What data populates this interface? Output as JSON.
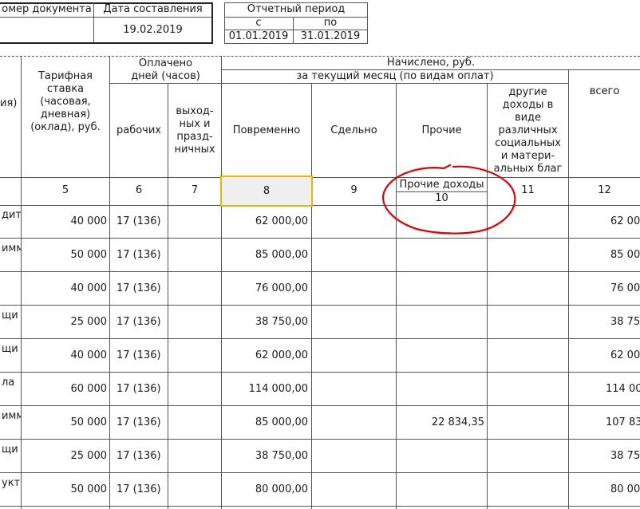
{
  "doc_header": {
    "doc_number_label": "омер документа",
    "date_label": "Дата составления",
    "date_value": "19.02.2019",
    "period_label": "Отчетный период",
    "period_from_label": "с",
    "period_to_label": "по",
    "period_from": "01.01.2019",
    "period_to": "31.01.2019"
  },
  "table": {
    "headers": {
      "partial_col": "ия)",
      "tariff": "Тарифная\nставка\n(часовая,\nдневная)\n(оклад), руб.",
      "paid_days_group": "Оплачено\nдней (часов)",
      "working": "рабочих",
      "weekend": "выход-\nных и\nпразд-\nничных",
      "accrued_group": "Начислено, руб.",
      "current_month_group": "за текущий месяц (по видам оплат)",
      "time_based": "Повременно",
      "piece": "Сдельно",
      "other": "Прочие",
      "other_income": "другие\nдоходы в\nвиде\nразличных\nсоциальных\nи матери-\nальных благ",
      "total": "всего"
    },
    "col_numbers": [
      "5",
      "6",
      "7",
      "8",
      "9",
      "11",
      "12"
    ],
    "other_income_sub": {
      "label": "Прочие доходы",
      "number": "10"
    },
    "rows": [
      {
        "partial_name": "дит",
        "tariff": "40 000",
        "working": "17 (136)",
        "time_based": "62 000,00",
        "other": "",
        "total": "62 00"
      },
      {
        "partial_name": "имм",
        "tariff": "50 000",
        "working": "17 (136)",
        "time_based": "85 000,00",
        "other": "",
        "total": "85 00"
      },
      {
        "partial_name": "",
        "tariff": "40 000",
        "working": "17 (136)",
        "time_based": "76 000,00",
        "other": "",
        "total": "76 00"
      },
      {
        "partial_name": "щи",
        "tariff": "25 000",
        "working": "17 (136)",
        "time_based": "38 750,00",
        "other": "",
        "total": "38 75"
      },
      {
        "partial_name": "щи",
        "tariff": "40 000",
        "working": "17 (136)",
        "time_based": "62 000,00",
        "other": "",
        "total": "62 00"
      },
      {
        "partial_name": "ла",
        "tariff": "60 000",
        "working": "17 (136)",
        "time_based": "114 000,00",
        "other": "",
        "total": "114 00"
      },
      {
        "partial_name": "имм",
        "tariff": "50 000",
        "working": "17 (136)",
        "time_based": "85 000,00",
        "other": "22 834,35",
        "total": "107 83"
      },
      {
        "partial_name": "щи",
        "tariff": "25 000",
        "working": "17 (136)",
        "time_based": "38 750,00",
        "other": "",
        "total": "38 75"
      },
      {
        "partial_name": "укт",
        "tariff": "50 000",
        "working": "17 (136)",
        "time_based": "80 000,00",
        "other": "",
        "total": "80 00"
      }
    ]
  },
  "colors": {
    "selection_border": "#e6b800",
    "selection_fill": "#efefef",
    "annotation_red": "#e00000"
  }
}
